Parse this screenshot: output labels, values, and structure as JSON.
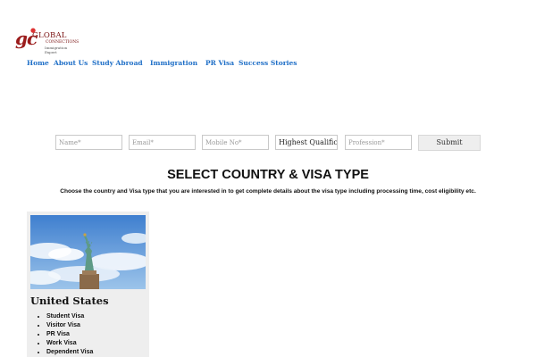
{
  "logo": {
    "mark": "gc",
    "name": "GLOBAL",
    "sub": "CONNECTIONS",
    "tagline": "Immigration Expert"
  },
  "nav": {
    "items": [
      {
        "label": "Home"
      },
      {
        "label": "About Us"
      },
      {
        "label": "Study Abroad"
      },
      {
        "label": "Immigration"
      },
      {
        "label": "PR Visa"
      },
      {
        "label": "Success Stories"
      }
    ]
  },
  "form": {
    "name_placeholder": "Name*",
    "email_placeholder": "Email*",
    "mobile_placeholder": "Mobile No*",
    "qualification_value": "Highest Qualifica",
    "profession_placeholder": "Profession*",
    "submit_label": "Submit"
  },
  "section": {
    "title": "SELECT COUNTRY & VISA TYPE",
    "subtitle": "Choose the country and Visa type that you are interested in to get complete details about the visa type including processing time, cost eligibility etc."
  },
  "card": {
    "country": "United States",
    "visa_types": [
      {
        "label": "Student Visa"
      },
      {
        "label": "Visitor Visa"
      },
      {
        "label": "PR Visa"
      },
      {
        "label": "Work Visa"
      },
      {
        "label": "Dependent Visa"
      }
    ]
  },
  "colors": {
    "nav_link": "#1f6fc7",
    "logo": "#9b1c1c",
    "card_bg": "#eeeeee"
  }
}
